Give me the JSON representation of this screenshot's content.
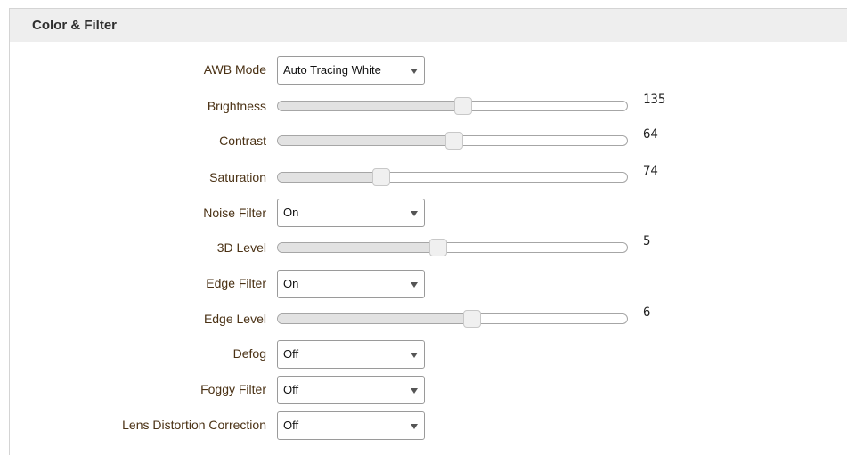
{
  "section": {
    "title": "Color & Filter"
  },
  "awb_mode": {
    "label": "AWB Mode",
    "value": "Auto Tracing White"
  },
  "brightness": {
    "label": "Brightness",
    "value": "135",
    "fraction": 0.53
  },
  "contrast": {
    "label": "Contrast",
    "value": "64",
    "fraction": 0.505
  },
  "saturation": {
    "label": "Saturation",
    "value": "74",
    "fraction": 0.295
  },
  "noise_filter": {
    "label": "Noise Filter",
    "value": "On"
  },
  "level_3d": {
    "label": "3D Level",
    "value": "5",
    "fraction": 0.46
  },
  "edge_filter": {
    "label": "Edge Filter",
    "value": "On"
  },
  "edge_level": {
    "label": "Edge Level",
    "value": "6",
    "fraction": 0.555
  },
  "defog": {
    "label": "Defog",
    "value": "Off"
  },
  "foggy_filter": {
    "label": "Foggy Filter",
    "value": "Off"
  },
  "lens_distortion": {
    "label": "Lens Distortion Correction",
    "value": "Off"
  },
  "colors": {
    "label": "#4a3114",
    "track_fill": "#e2e2e2",
    "header_bg": "#eeeeee"
  },
  "icons": {
    "dropdown": "chevron-down-icon"
  }
}
